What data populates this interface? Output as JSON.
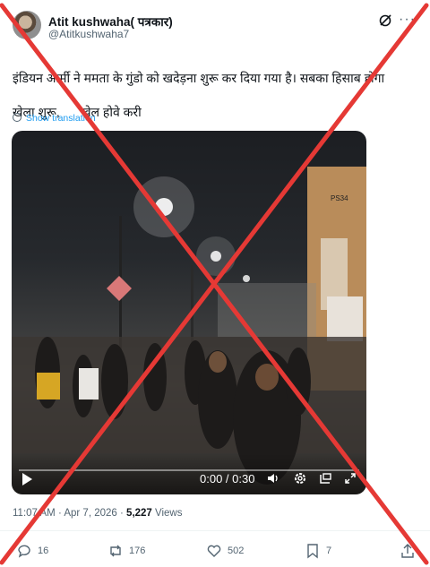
{
  "author": {
    "name": "Atit kushwaha( पत्रकार)",
    "handle": "@Atitkushwaha7"
  },
  "header_icons": [
    "grok-icon",
    "more-icon"
  ],
  "tweet": {
    "line1": "इंडियन आर्मी ने ममता के गुंडो को खदेड़ना शुरू कर दिया गया है। सबका हिसाब होगा",
    "line2": "खेला शुरू,      खेल होवे करी",
    "show_translation": "Show translation"
  },
  "video": {
    "time": "0:00 / 0:30",
    "progress": 0.0,
    "controls": [
      "play-icon",
      "volume-icon",
      "settings-icon",
      "pip-icon",
      "fullscreen-icon"
    ],
    "sign_text": "PS34"
  },
  "meta": {
    "time": "11:07 AM",
    "separator1": " · ",
    "date": "Apr 7, 2026",
    "separator2": " · ",
    "views_count": "5,227",
    "views_label": " Views"
  },
  "actions": {
    "replies": "16",
    "reposts": "176",
    "likes": "502",
    "bookmarks": "7"
  },
  "overlay": {
    "mark": "red-cross",
    "color": "#e53935"
  }
}
